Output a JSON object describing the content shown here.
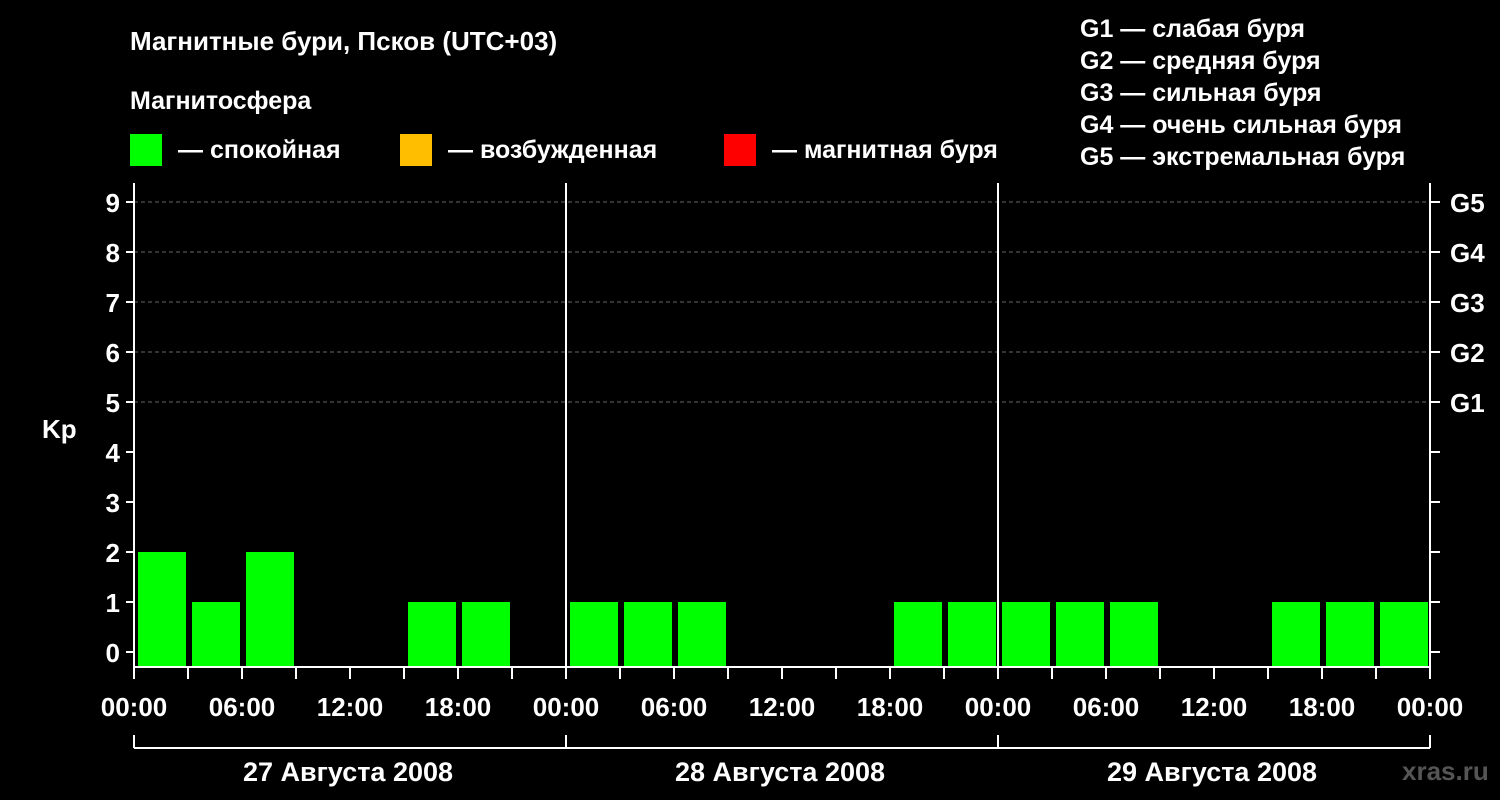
{
  "chart_data": {
    "type": "bar",
    "title": "Магнитные бури, Псков (UTC+03)",
    "legend_title": "Магнитосфера",
    "legend": [
      {
        "label": "— спокойная",
        "color": "#00ff00"
      },
      {
        "label": "— возбужденная",
        "color": "#ffbf00"
      },
      {
        "label": "— магнитная буря",
        "color": "#ff0000"
      }
    ],
    "g_scale_legend": [
      "G1 — слабая буря",
      "G2 — средняя буря",
      "G3 — сильная буря",
      "G4 — очень сильная буря",
      "G5 — экстремальная буря"
    ],
    "ylabel": "Kp",
    "ylim": [
      0,
      9
    ],
    "yticks": [
      "0",
      "1",
      "2",
      "3",
      "4",
      "5",
      "6",
      "7",
      "8",
      "9"
    ],
    "right_ticks": [
      {
        "y": 5,
        "label": "G1"
      },
      {
        "y": 6,
        "label": "G2"
      },
      {
        "y": 7,
        "label": "G3"
      },
      {
        "y": 8,
        "label": "G4"
      },
      {
        "y": 9,
        "label": "G5"
      }
    ],
    "grid": "horizontal-dashed",
    "xticks": [
      "00:00",
      "06:00",
      "12:00",
      "18:00",
      "00:00",
      "06:00",
      "12:00",
      "18:00",
      "00:00",
      "06:00",
      "12:00",
      "18:00",
      "00:00"
    ],
    "days": [
      "27 Августа 2008",
      "28 Августа 2008",
      "29 Августа 2008"
    ],
    "bar_color": "#00ff00",
    "values": [
      [
        2,
        1,
        2,
        0,
        0,
        1,
        1,
        0
      ],
      [
        1,
        1,
        1,
        0,
        0,
        0,
        1,
        1
      ],
      [
        1,
        1,
        1,
        0,
        0,
        1,
        1,
        1
      ]
    ]
  },
  "watermark": "xras.ru"
}
